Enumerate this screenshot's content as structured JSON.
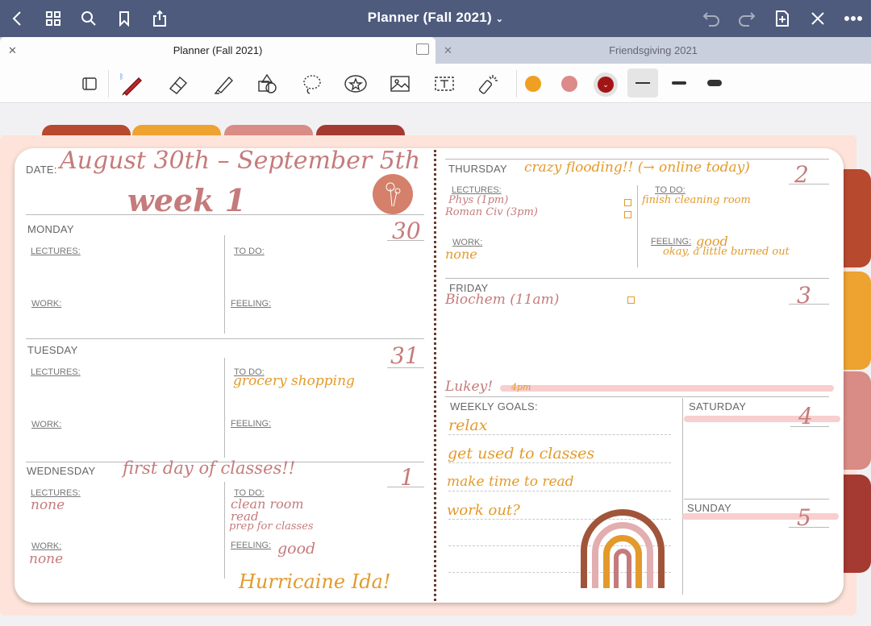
{
  "nav": {
    "title": "Planner (Fall 2021)"
  },
  "tabs": [
    {
      "label": "Planner (Fall 2021)",
      "active": true
    },
    {
      "label": "Friendsgiving 2021",
      "active": false
    }
  ],
  "colors": {
    "nav_bg": "#4e5b7d",
    "swatch_orange": "#f0a020",
    "swatch_pink": "#dd8a8a",
    "swatch_red": "#a31515",
    "tab_rust": "#b7492e",
    "tab_orange": "#eea22f",
    "tab_pink": "#d98b85",
    "tab_brick": "#a53a32"
  },
  "planner": {
    "date_label": "DATE:",
    "date_value": "August 30th – September 5th",
    "week": "week 1",
    "days": {
      "monday": {
        "label": "MONDAY",
        "num": "30",
        "lectures_label": "LECTURES:",
        "todo_label": "TO DO:",
        "work_label": "WORK:",
        "feeling_label": "FEELING:"
      },
      "tuesday": {
        "label": "TUESDAY",
        "num": "31",
        "lectures_label": "LECTURES:",
        "todo_label": "TO DO:",
        "work_label": "WORK:",
        "feeling_label": "FEELING:",
        "todo_1": "grocery shopping"
      },
      "wednesday": {
        "label": "WEDNESDAY",
        "num": "1",
        "note": "first day of classes!!",
        "lectures_label": "LECTURES:",
        "lectures_value": "none",
        "todo_label": "TO DO:",
        "todo_1": "clean room",
        "todo_2": "read",
        "todo_3": "prep for classes",
        "work_label": "WORK:",
        "work_value": "none",
        "feeling_label": "FEELING:",
        "feeling_value": "good",
        "extra": "Hurricaine Ida!"
      },
      "thursday": {
        "label": "THURSDAY",
        "num": "2",
        "note": "crazy flooding!! (→ online today)",
        "lectures_label": "LECTURES:",
        "lecture_1": "Phys (1pm)",
        "lecture_2": "Roman Civ (3pm)",
        "todo_label": "TO DO:",
        "todo_1": "finish cleaning room",
        "work_label": "WORK:",
        "work_value": "none",
        "feeling_label": "FEELING:",
        "feeling_1": "good",
        "feeling_2": "okay, a little burned out"
      },
      "friday": {
        "label": "FRIDAY",
        "num": "3",
        "entry": "Biochem (11am)",
        "event": "Lukey!",
        "event_time": "4pm"
      },
      "saturday": {
        "label": "SATURDAY",
        "num": "4"
      },
      "sunday": {
        "label": "SUNDAY",
        "num": "5"
      }
    },
    "goals": {
      "label": "WEEKLY GOALS:",
      "items": [
        "relax",
        "get used to classes",
        "make time to read",
        "work out?"
      ]
    }
  }
}
